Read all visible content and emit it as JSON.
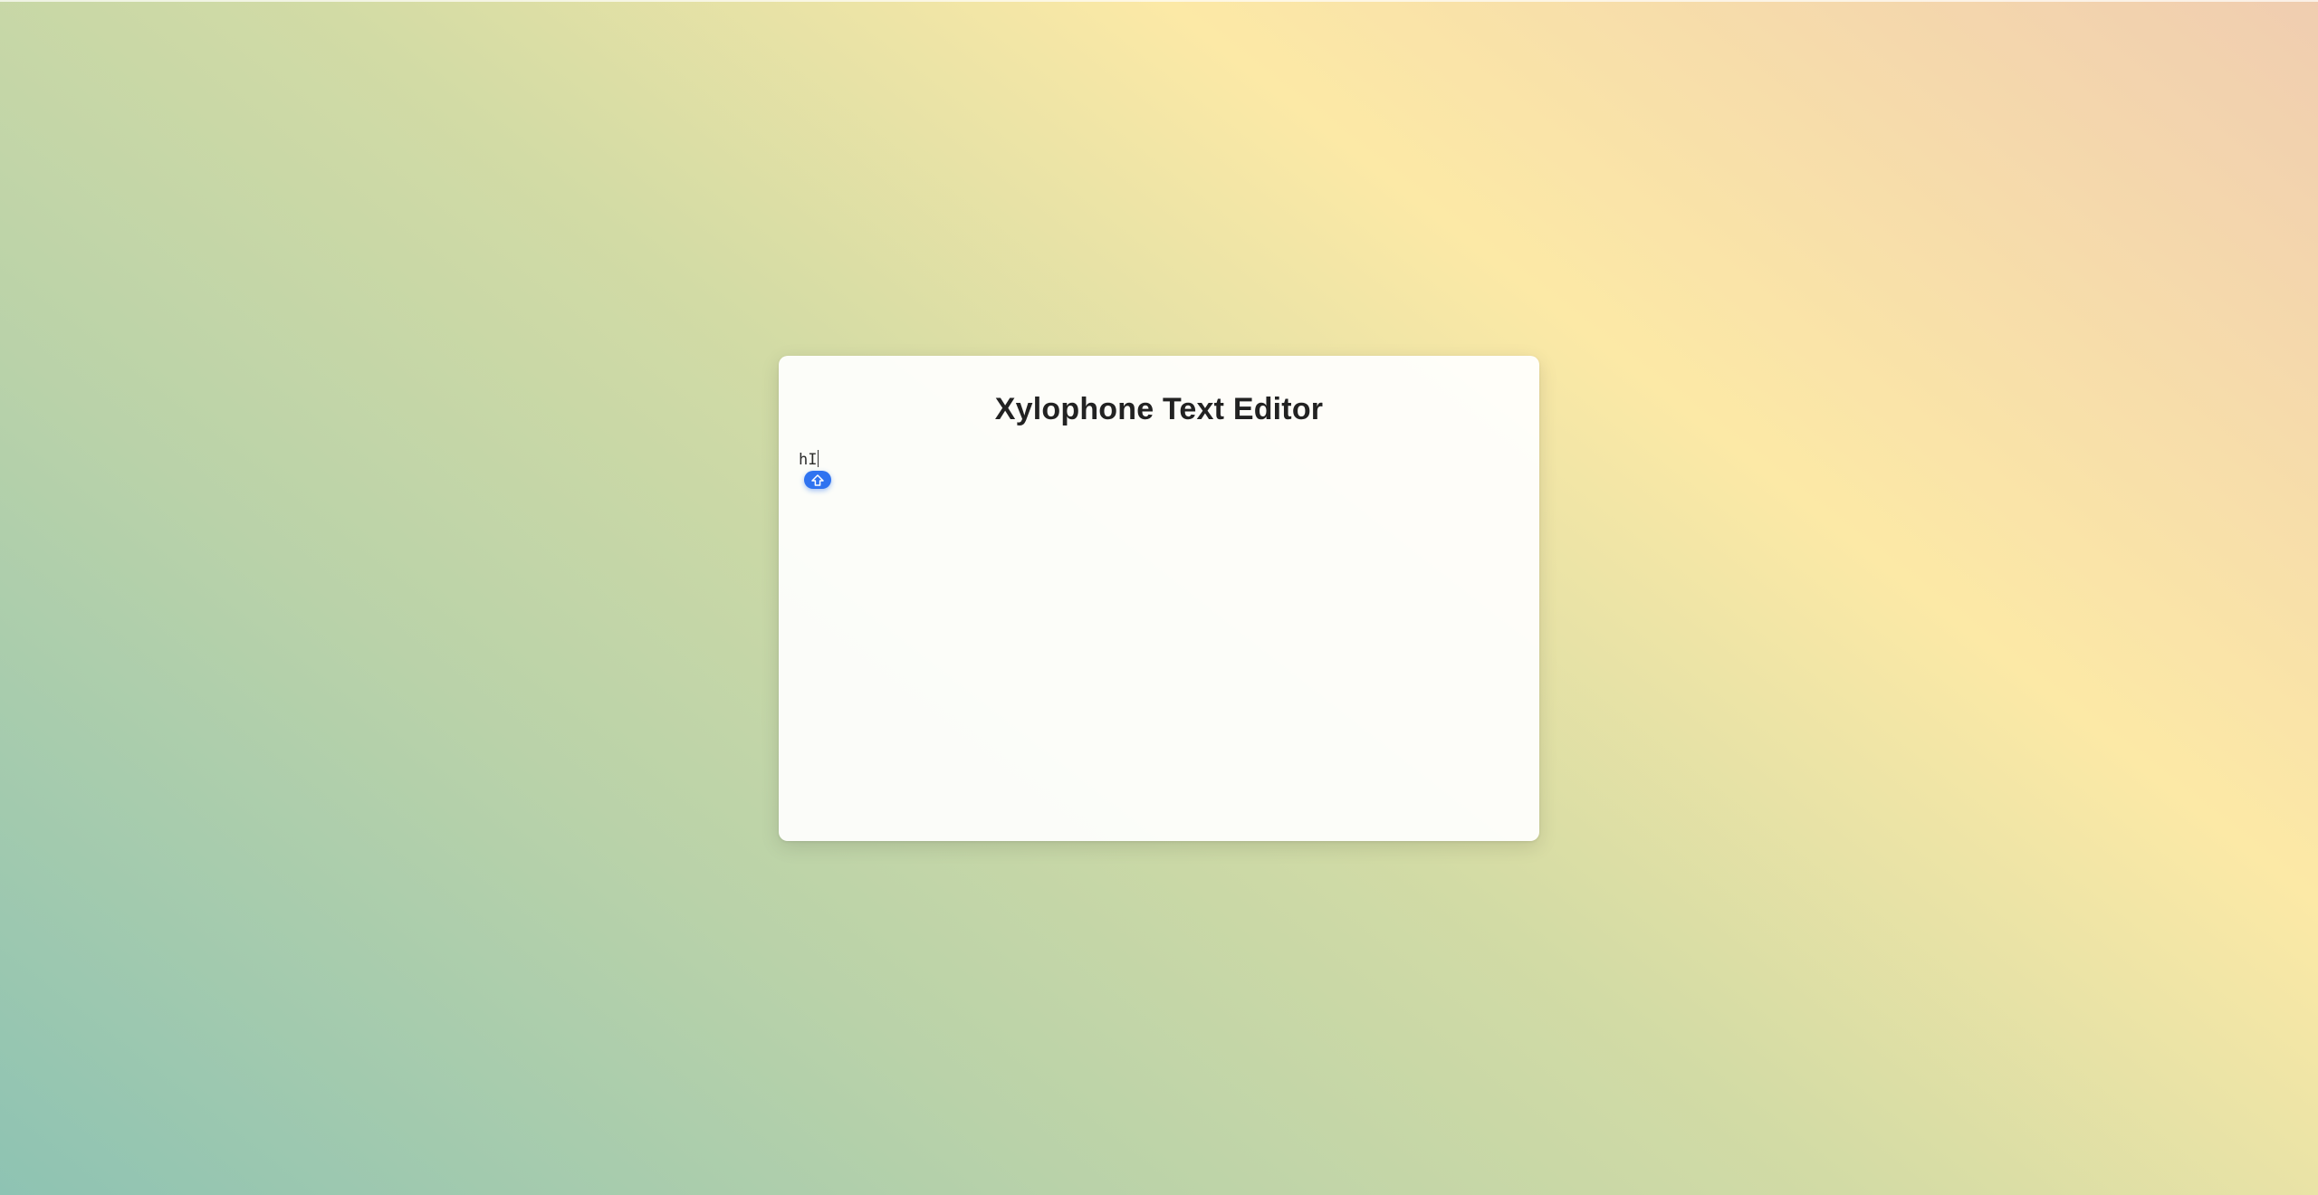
{
  "editor": {
    "title": "Xylophone Text Editor",
    "content": "hI"
  },
  "cursor_badge": {
    "icon": "shift-key-icon",
    "color": "#2f73f0"
  }
}
